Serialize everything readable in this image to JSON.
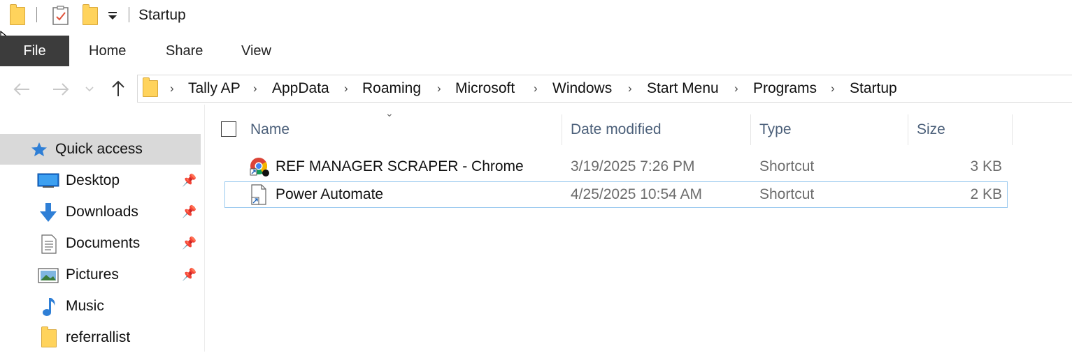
{
  "window": {
    "title": "Startup"
  },
  "ribbon": {
    "tabs": [
      {
        "label": "File"
      },
      {
        "label": "Home"
      },
      {
        "label": "Share"
      },
      {
        "label": "View"
      }
    ]
  },
  "address": {
    "breadcrumbs": [
      "Tally AP",
      "AppData",
      "Roaming",
      "Microsoft",
      "Windows",
      "Start Menu",
      "Programs",
      "Startup"
    ]
  },
  "navpane": {
    "items": [
      {
        "label": "Quick access",
        "icon": "star-icon",
        "pinned": false,
        "selected": true
      },
      {
        "label": "Desktop",
        "icon": "desktop-icon",
        "pinned": true
      },
      {
        "label": "Downloads",
        "icon": "download-arrow-icon",
        "pinned": true
      },
      {
        "label": "Documents",
        "icon": "document-icon",
        "pinned": true
      },
      {
        "label": "Pictures",
        "icon": "pictures-icon",
        "pinned": true
      },
      {
        "label": "Music",
        "icon": "music-note-icon",
        "pinned": false
      },
      {
        "label": "referrallist",
        "icon": "folder-icon",
        "pinned": false
      }
    ]
  },
  "list": {
    "columns": {
      "name": "Name",
      "date": "Date modified",
      "type": "Type",
      "size": "Size"
    },
    "rows": [
      {
        "name": "REF MANAGER SCRAPER - Chrome",
        "date": "3/19/2025 7:26 PM",
        "type": "Shortcut",
        "size": "3 KB",
        "icon": "chrome-shortcut-icon"
      },
      {
        "name": "Power Automate",
        "date": "4/25/2025 10:54 AM",
        "type": "Shortcut",
        "size": "2 KB",
        "icon": "shortcut-file-icon"
      }
    ]
  },
  "colors": {
    "file_tab_bg": "#3c3c3c",
    "selected_nav_bg": "#d9d9d9",
    "focus_border": "#99c9ef",
    "column_header_text": "#4c607a",
    "folder_yellow": "#ffd35c"
  }
}
